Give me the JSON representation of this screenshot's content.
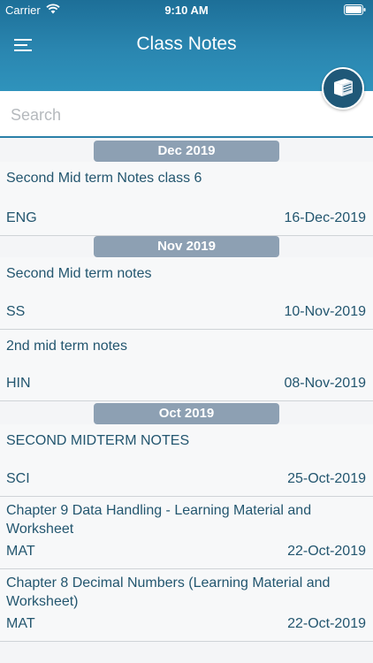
{
  "status_bar": {
    "carrier": "Carrier",
    "time": "9:10 AM"
  },
  "header": {
    "title": "Class Notes"
  },
  "search": {
    "placeholder": "Search"
  },
  "groups": [
    {
      "month": "Dec 2019",
      "notes": [
        {
          "title": "Second Mid term Notes class 6",
          "subject": "ENG",
          "date": "16-Dec-2019"
        }
      ]
    },
    {
      "month": "Nov 2019",
      "notes": [
        {
          "title": "Second Mid term notes",
          "subject": "SS",
          "date": "10-Nov-2019"
        },
        {
          "title": "2nd  mid term notes",
          "subject": "HIN",
          "date": "08-Nov-2019"
        }
      ]
    },
    {
      "month": "Oct 2019",
      "notes": [
        {
          "title": "SECOND MIDTERM NOTES",
          "subject": "SCI",
          "date": "25-Oct-2019"
        },
        {
          "title": "Chapter  9 Data Handling - Learning Material and Worksheet",
          "subject": "MAT",
          "date": "22-Oct-2019"
        },
        {
          "title": "Chapter 8  Decimal Numbers (Learning Material and Worksheet)",
          "subject": "MAT",
          "date": "22-Oct-2019"
        }
      ]
    }
  ],
  "colors": {
    "header": "#2a86b0",
    "month_badge": "#8da0b3",
    "text": "#23566f",
    "book_button": "#1f5878"
  },
  "icons": {
    "menu": "hamburger-menu-icon",
    "book": "book-icon",
    "wifi": "wifi-icon",
    "battery": "battery-icon"
  }
}
